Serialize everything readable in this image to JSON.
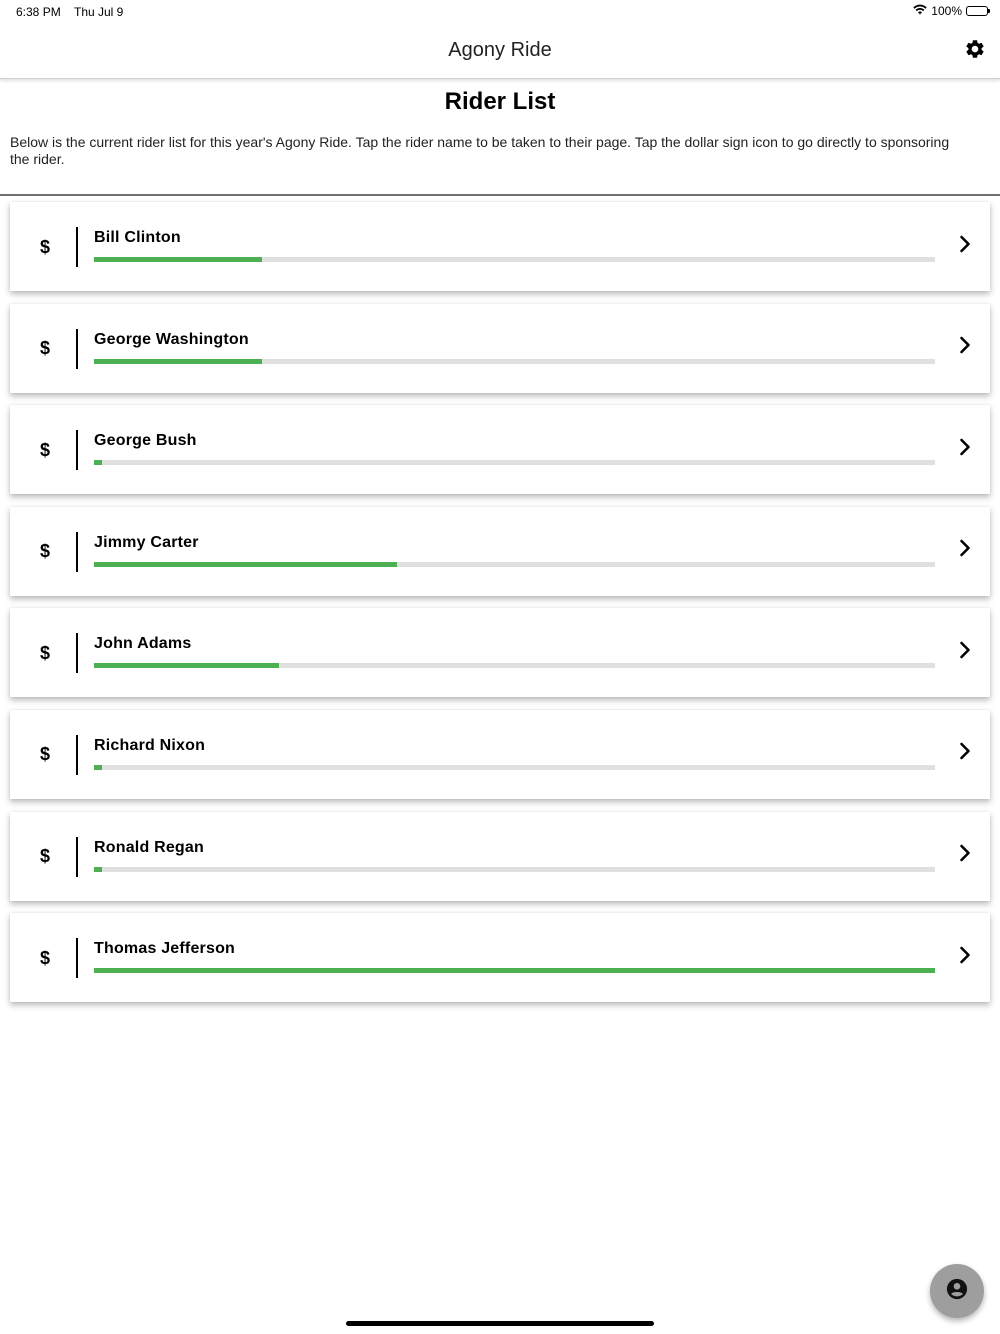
{
  "status_bar": {
    "time": "6:38 PM",
    "date": "Thu Jul 9",
    "battery": "100%"
  },
  "nav": {
    "title": "Agony Ride"
  },
  "page": {
    "title": "Rider List",
    "description": "Below is the current rider list for this year's Agony Ride. Tap the rider name to be taken to their page. Tap the dollar sign icon to go directly to sponsoring the rider."
  },
  "dollar_symbol": "$",
  "riders": [
    {
      "name": "Bill Clinton",
      "progress": 0.2
    },
    {
      "name": "George Washington",
      "progress": 0.2
    },
    {
      "name": "George Bush",
      "progress": 0.01
    },
    {
      "name": "Jimmy Carter",
      "progress": 0.36
    },
    {
      "name": "John Adams",
      "progress": 0.22
    },
    {
      "name": "Richard Nixon",
      "progress": 0.01
    },
    {
      "name": "Ronald Regan",
      "progress": 0.01
    },
    {
      "name": "Thomas Jefferson",
      "progress": 1.0
    }
  ],
  "colors": {
    "progress_fill": "#4caf50",
    "progress_track": "#e0e0e0",
    "fab": "#9e9e9e"
  },
  "icons": {
    "settings": "gear-icon",
    "row_action": "chevron-right-icon",
    "fab": "account-circle-icon"
  }
}
